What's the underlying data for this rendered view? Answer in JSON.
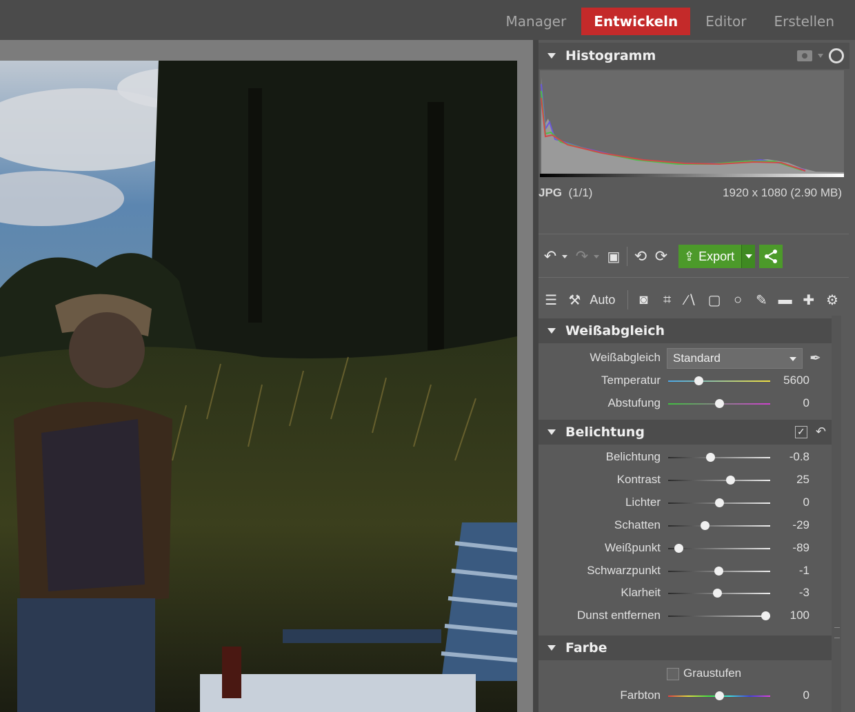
{
  "nav": {
    "tabs": [
      {
        "label": "Manager",
        "active": false
      },
      {
        "label": "Entwickeln",
        "active": true
      },
      {
        "label": "Editor",
        "active": false
      },
      {
        "label": "Erstellen",
        "active": false
      }
    ]
  },
  "histogram": {
    "title": "Histogramm",
    "format": "JPG",
    "count": "(1/1)",
    "dimensions": "1920 x 1080 (2.90 MB)"
  },
  "toolbar": {
    "export_label": "Export",
    "auto_label": "Auto"
  },
  "white_balance": {
    "title": "Weißabgleich",
    "select_label": "Weißabgleich",
    "select_value": "Standard",
    "sliders": [
      {
        "label": "Temperatur",
        "value": "5600",
        "pos": 0.3,
        "track": "temperature"
      },
      {
        "label": "Abstufung",
        "value": "0",
        "pos": 0.5,
        "track": "tint"
      }
    ]
  },
  "exposure": {
    "title": "Belichtung",
    "sliders": [
      {
        "label": "Belichtung",
        "value": "-0.8",
        "pos": 0.41
      },
      {
        "label": "Kontrast",
        "value": "25",
        "pos": 0.61
      },
      {
        "label": "Lichter",
        "value": "0",
        "pos": 0.5
      },
      {
        "label": "Schatten",
        "value": "-29",
        "pos": 0.36
      },
      {
        "label": "Weißpunkt",
        "value": "-89",
        "pos": 0.1
      },
      {
        "label": "Schwarzpunkt",
        "value": "-1",
        "pos": 0.49
      },
      {
        "label": "Klarheit",
        "value": "-3",
        "pos": 0.48
      },
      {
        "label": "Dunst entfernen",
        "value": "100",
        "pos": 0.95
      }
    ]
  },
  "color": {
    "title": "Farbe",
    "grayscale_label": "Graustufen",
    "hue": {
      "label": "Farbton",
      "value": "0",
      "pos": 0.5
    }
  },
  "colors": {
    "active_tab": "#c42a2a",
    "export_green": "#4c9a2a"
  }
}
